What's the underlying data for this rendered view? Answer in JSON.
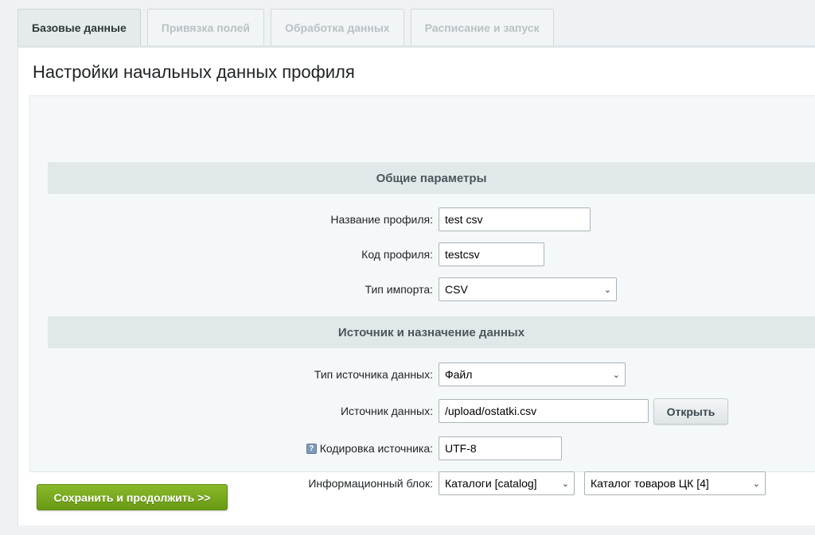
{
  "tabs": [
    {
      "label": "Базовые данные",
      "active": true
    },
    {
      "label": "Привязка полей",
      "active": false
    },
    {
      "label": "Обработка данных",
      "active": false
    },
    {
      "label": "Расписание и запуск",
      "active": false
    }
  ],
  "page_title": "Настройки начальных данных профиля",
  "sections": {
    "general": "Общие параметры",
    "source": "Источник и назначение данных"
  },
  "fields": {
    "profile_name": {
      "label": "Название профиля:",
      "value": "test csv"
    },
    "profile_code": {
      "label": "Код профиля:",
      "value": "testcsv"
    },
    "import_type": {
      "label": "Тип импорта:",
      "value": "CSV"
    },
    "source_type": {
      "label": "Тип источника данных:",
      "value": "Файл"
    },
    "data_source": {
      "label": "Источник данных:",
      "value": "/upload/ostatki.csv",
      "button": "Открыть"
    },
    "encoding": {
      "label": "Кодировка источника:",
      "value": "UTF-8",
      "help_icon": "?"
    },
    "iblock": {
      "label": "Информационный блок:",
      "type_value": "Каталоги [catalog]",
      "block_value": "Каталог товаров ЦК [4]"
    }
  },
  "save_button": "Сохранить и продолжить >>",
  "icons": {
    "select_arrow": "chevron-down-icon",
    "help": "help-icon"
  },
  "colors": {
    "accent_green": "#77a81c",
    "section_bg": "#e0e8ea",
    "page_bg": "#eef2f4"
  }
}
